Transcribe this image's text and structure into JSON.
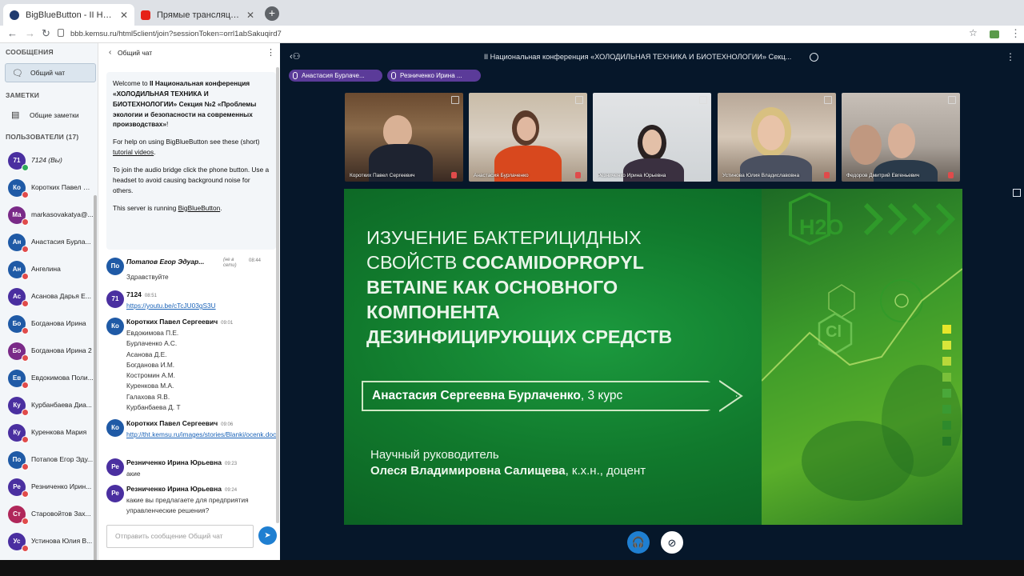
{
  "browser": {
    "tabs": [
      {
        "label": "BigBlueButton - II Национальная",
        "active": true
      },
      {
        "label": "Прямые трансляции - YouTube",
        "active": false
      }
    ],
    "new_tab": "+",
    "url": "bbb.kemsu.ru/html5client/join?sessionToken=orrl1abSakuqird7"
  },
  "sidebar": {
    "messages_header": "СООБЩЕНИЯ",
    "public_chat": "Общий чат",
    "notes_header": "ЗАМЕТКИ",
    "shared_notes": "Общие заметки",
    "users_header": "ПОЛЬЗОВАТЕЛИ (17)",
    "users": [
      {
        "initials": "71",
        "name": "7124 (Вы)",
        "color": "#4a2fa0"
      },
      {
        "initials": "Ко",
        "name": "Коротких Павел С...",
        "color": "#1f5aa6"
      },
      {
        "initials": "Ма",
        "name": "markasovakatya@...",
        "color": "#7a2a88"
      },
      {
        "initials": "Ан",
        "name": "Анастасия Бурла...",
        "color": "#1f5aa6"
      },
      {
        "initials": "Ан",
        "name": "Ангелина",
        "color": "#1f5aa6"
      },
      {
        "initials": "Ас",
        "name": "Асанова Дарья Е...",
        "color": "#4a2fa0"
      },
      {
        "initials": "Бо",
        "name": "Богданова Ирина",
        "color": "#1f5aa6"
      },
      {
        "initials": "Бо",
        "name": "Богданова Ирина 2",
        "color": "#7a2a88"
      },
      {
        "initials": "Ев",
        "name": "Евдокимова Поли...",
        "color": "#1f5aa6"
      },
      {
        "initials": "Ку",
        "name": "Курбанбаева Диа...",
        "color": "#4a2fa0"
      },
      {
        "initials": "Ку",
        "name": "Куренкова Мария",
        "color": "#4a2fa0"
      },
      {
        "initials": "По",
        "name": "Потапов Егор Эду...",
        "color": "#1f5aa6"
      },
      {
        "initials": "Ре",
        "name": "Резниченко Ирин...",
        "color": "#4a2fa0"
      },
      {
        "initials": "Ст",
        "name": "Старовойтов Зах...",
        "color": "#b0275a"
      },
      {
        "initials": "Ус",
        "name": "Устинова Юлия В...",
        "color": "#4a2fa0"
      }
    ]
  },
  "chat": {
    "title": "Общий чат",
    "welcome": {
      "line1": "Welcome to ",
      "line1b": "II Национальная конференция «ХОЛОДИЛЬНАЯ ТЕХНИКА И БИОТЕХНОЛОГИИ» Секция №2 «Проблемы экологии и безопасности на современных производствах»",
      "line1end": "!",
      "help": "For help on using BigBlueButton see these (short) ",
      "help_link": "tutorial videos",
      "help_end": ".",
      "audio": "To join the audio bridge click the phone button. Use a headset to avoid causing background noise for others.",
      "server": "This server is running ",
      "server_link": "BigBlueButton",
      "server_end": "."
    },
    "messages": [
      {
        "initials": "По",
        "color": "#1f5aa6",
        "name": "Потапов Егор Эдуар...",
        "status": "(не в сети)",
        "time": "08:44",
        "text": "Здравствуйте"
      },
      {
        "initials": "71",
        "color": "#4a2fa0",
        "name": "7124",
        "time": "08:51",
        "link": "https://youtu.be/cTcJU03gS3U"
      },
      {
        "initials": "Ко",
        "color": "#1f5aa6",
        "name": "Коротких Павел Сергеевич",
        "time": "09:01",
        "lines": [
          "Евдокимова П.Е.",
          "Бурлаченко А.С.",
          "Асанова Д.Е.",
          "Богданова И.М.",
          "Костромин А.М.",
          "Куренкова М.А.",
          "Галахова Я.В.",
          "Курбанбаева Д. Т"
        ]
      },
      {
        "initials": "Ко",
        "color": "#1f5aa6",
        "name": "Коротких Павел Сергеевич",
        "time": "09:06",
        "link": "http://tht.kemsu.ru/images/stories/Blanki/ocenk.doc"
      },
      {
        "initials": "Ре",
        "color": "#4a2fa0",
        "name": "Резниченко Ирина Юрьевна",
        "time": "09:23",
        "text": "акие"
      },
      {
        "initials": "Ре",
        "color": "#4a2fa0",
        "name": "Резниченко Ирина Юрьевна",
        "time": "09:24",
        "text": "какие вы предлагаете для предприятия управленческие решения?"
      }
    ],
    "input_placeholder": "Отправить сообщение Общий чат"
  },
  "main": {
    "meeting_title": "II Национальная конференция «ХОЛОДИЛЬНАЯ ТЕХНИКА И БИОТЕХНОЛОГИИ» Секц...",
    "talkers": [
      "Анастасия Бурлаче...",
      "Резниченко Ирина ..."
    ],
    "videos": [
      {
        "name": "Коротких Павел Сергеевич"
      },
      {
        "name": "Анастасия Бурлаченко"
      },
      {
        "name": "Резниченко Ирина Юрьевна"
      },
      {
        "name": "Устинова Юлия Владиславовна"
      },
      {
        "name": "Федоров Дмитрий Евгеньевич"
      }
    ],
    "slide": {
      "title_line1": "ИЗУЧЕНИЕ БАКТЕРИЦИДНЫХ",
      "title_line2a": "СВОЙСТВ ",
      "title_line2b": "COCAMIDOPROPYL",
      "title_line3": "BETAINE КАК ОСНОВНОГО",
      "title_line4": "КОМПОНЕНТА",
      "title_line5": "ДЕЗИНФИЦИРУЮЩИХ СРЕДСТВ",
      "presenter_name": "Анастасия Сергеевна Бурлаченко",
      "presenter_course": ", 3 курс",
      "advisor_label": "Научный руководитель",
      "advisor_name": "Олеся Владимировна Салищева",
      "advisor_title": ", к.х.н., доцент",
      "hex_h2o": "H2O",
      "hex_cl": "Cl"
    }
  }
}
